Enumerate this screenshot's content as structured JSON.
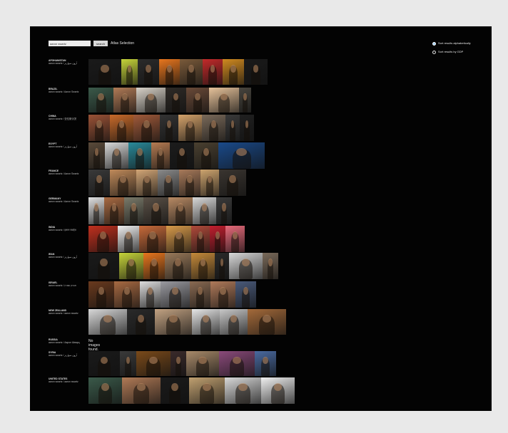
{
  "search": {
    "query": "aaron swartz",
    "button_label": "search"
  },
  "app_title": "Atlas Selection",
  "sort": {
    "options": [
      "Sort results alphabetically",
      "Sort results by GDP"
    ],
    "selected": 0
  },
  "rows": [
    {
      "country": "AFGHANISTAN",
      "query": "aaron swartz / آرون سوارتز",
      "thumbs": [
        "#1a1a1a",
        "#c6d43a",
        "#2b2b2b",
        "#e8761e",
        "#7a5a3a",
        "#c22a2a",
        "#d08a20",
        "#1a1a1a"
      ]
    },
    {
      "country": "BRAZIL",
      "query": "aaron swartz / Aaron Swartz",
      "thumbs": [
        "#3b5a4a",
        "#b07a56",
        "#d8d2c8",
        "#2e2a26",
        "#6a4a38",
        "#e6c29a",
        "#48453e"
      ]
    },
    {
      "country": "CHINA",
      "query": "aaron swartz / 亚伦斯沃茨",
      "thumbs": [
        "#9a5236",
        "#c86a2a",
        "#a05a3a",
        "#333",
        "#d4a26a",
        "#7a6a5a",
        "#3a3a3a",
        "#202020"
      ]
    },
    {
      "country": "EGYPT",
      "query": "aaron swartz / آرون سوارتز",
      "thumbs": [
        "#5a4a3a",
        "#d8d8d8",
        "#2a8a9a",
        "#b57b52",
        "#1c1c1c",
        "#4a4030",
        "#1a4a8a"
      ]
    },
    {
      "country": "FRANCE",
      "query": "aaron swartz / Aaron Swartz",
      "thumbs": [
        "#3a3a3a",
        "#c08a5a",
        "#d3a676",
        "#8a8a8a",
        "#a87a5a",
        "#cda46e",
        "#3a3530"
      ]
    },
    {
      "country": "GERMANY",
      "query": "aaron swartz / Aaron Swartz",
      "thumbs": [
        "#e0e0e0",
        "#a86a42",
        "#7a7a6a",
        "#5a5046",
        "#b88a64",
        "#d8d8d8",
        "#3a3a3a"
      ]
    },
    {
      "country": "INDIA",
      "query": "aaron swartz / हारून स्वार्ट्ज़",
      "thumbs": [
        "#c0301e",
        "#efefef",
        "#c76a3a",
        "#d89a4a",
        "#b04a3a",
        "#c21e2e",
        "#e86a7a"
      ]
    },
    {
      "country": "IRAN",
      "query": "aaron swartz / آرون سوارتز",
      "thumbs": [
        "#1a1a1a",
        "#c6d43a",
        "#e8761e",
        "#9a7a5a",
        "#c58a3a",
        "#2a2a2a",
        "#d8d8d8",
        "#7a6a5a"
      ]
    },
    {
      "country": "ISRAEL",
      "query": "aaron swartz / אהרון שוורץ",
      "thumbs": [
        "#6a3a1e",
        "#a86a42",
        "#ddd",
        "#9a9aa0",
        "#8a6a52",
        "#b07a5a",
        "#4a5a7a"
      ]
    },
    {
      "country": "NEW ZEALAND",
      "query": "aaron swartz / aaron swartz",
      "thumbs": [
        "#d8d8d8",
        "#2a2a2a",
        "#c2a282",
        "#e6e6e6",
        "#c8c8c8",
        "#a46a3a"
      ]
    },
    {
      "country": "RUSSIA",
      "query": "aaron swartz / Аарон Шварц",
      "no_images": "No images found.",
      "thumbs": []
    },
    {
      "country": "SYRIA",
      "query": "aaron swartz / آرون سوارتز",
      "thumbs": [
        "#1a1a1a",
        "#3a3a3a",
        "#7a4a1a",
        "#3a2a2a",
        "#a88a6a",
        "#8a4a7a",
        "#4a6aa0"
      ]
    },
    {
      "country": "UNITED STATES",
      "query": "aaron swartz / aaron swartz",
      "thumbs": [
        "#3b5a4a",
        "#b07a56",
        "#1a1a1a",
        "#c0a070",
        "#d8d8d8",
        "#f0f0f0"
      ]
    }
  ]
}
